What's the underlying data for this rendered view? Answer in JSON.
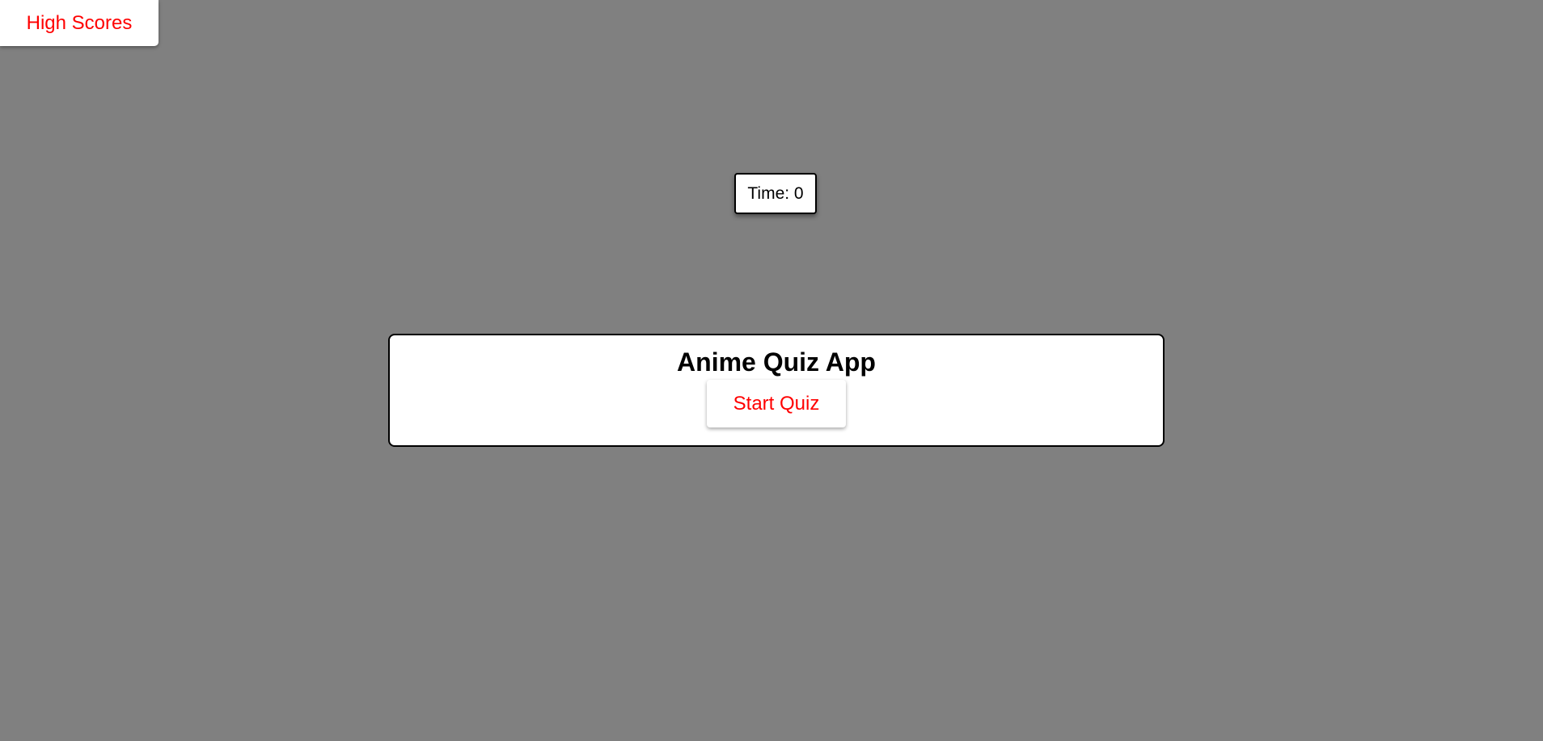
{
  "nav": {
    "high_scores_label": "High Scores"
  },
  "timer": {
    "text": "Time: 0"
  },
  "quiz": {
    "title": "Anime Quiz App",
    "start_label": "Start Quiz"
  },
  "colors": {
    "background": "#808080",
    "accent_text": "#ff0000",
    "card": "#ffffff"
  }
}
